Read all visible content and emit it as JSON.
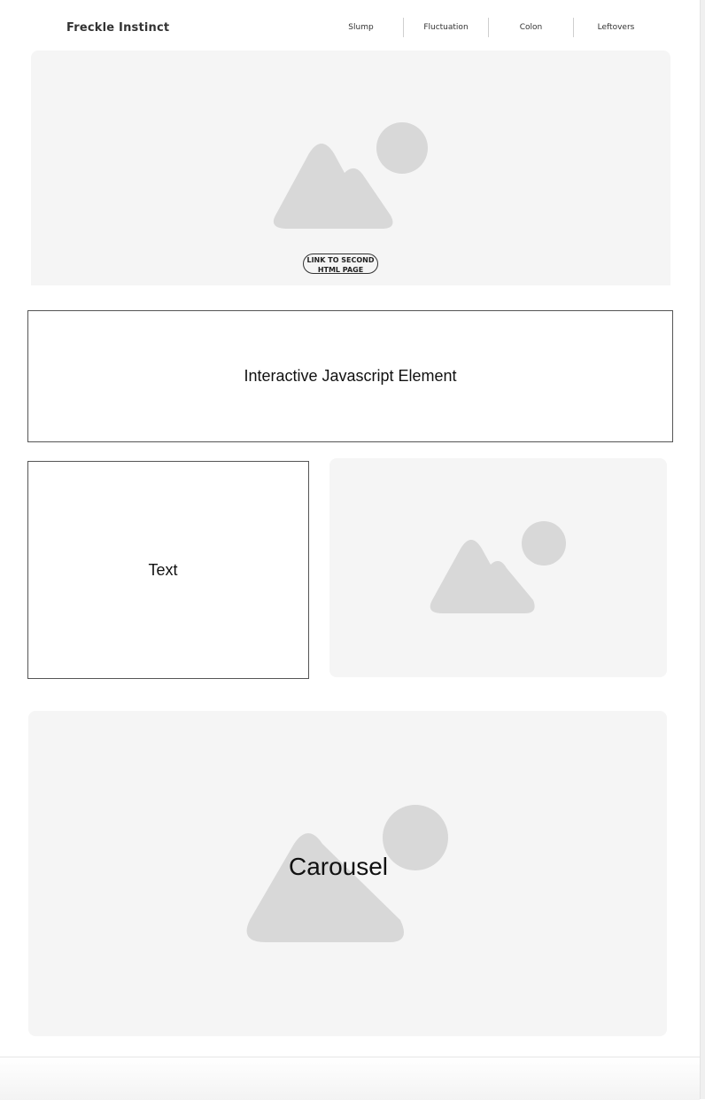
{
  "header": {
    "brand": "Freckle Instinct",
    "nav": [
      "Slump",
      "Fluctuation",
      "Colon",
      "Leftovers"
    ]
  },
  "hero": {
    "link_label": "LINK TO SECOND HTML PAGE"
  },
  "js_section": {
    "label": "Interactive Javascript Element"
  },
  "text_section": {
    "label": "Text"
  },
  "carousel": {
    "label": "Carousel"
  },
  "icons": {
    "placeholder": "image-placeholder-icon"
  },
  "colors": {
    "panel_bg": "#f5f5f5",
    "placeholder_shape": "#d8d8d8",
    "border": "#555555"
  }
}
